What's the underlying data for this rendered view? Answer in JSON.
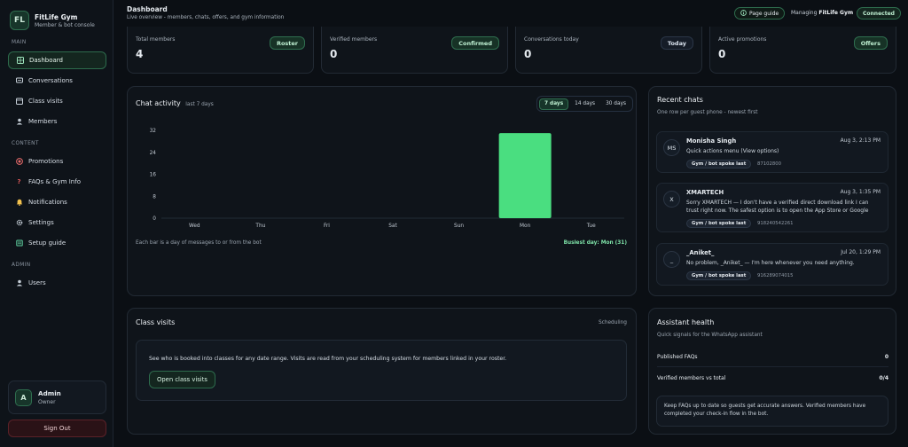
{
  "brand": {
    "logo": "FL",
    "name": "FitLife Gym",
    "subtitle": "Member & bot console"
  },
  "sidebar": {
    "sections": {
      "main": "MAIN",
      "content": "CONTENT",
      "admin": "ADMIN"
    },
    "items": [
      {
        "label": "Dashboard",
        "icon": "grid-icon",
        "active": true
      },
      {
        "label": "Conversations",
        "icon": "chat-icon"
      },
      {
        "label": "Class visits",
        "icon": "calendar-icon"
      },
      {
        "label": "Members",
        "icon": "users-icon"
      },
      {
        "label": "Promotions",
        "icon": "target-icon"
      },
      {
        "label": "FAQs & Gym Info",
        "icon": "question-icon"
      },
      {
        "label": "Notifications",
        "icon": "bell-icon"
      },
      {
        "label": "Settings",
        "icon": "gear-icon"
      },
      {
        "label": "Setup guide",
        "icon": "book-icon"
      },
      {
        "label": "Users",
        "icon": "users-icon"
      }
    ],
    "user": {
      "initial": "A",
      "name": "Admin",
      "role": "Owner"
    },
    "signout": "Sign Out"
  },
  "header": {
    "title": "Dashboard",
    "subtitle": "Live overview - members, chats, offers, and gym information",
    "page_guide": "Page guide",
    "managing_prefix": "Managing",
    "managing_name": "FitLife Gym",
    "status": "Connected"
  },
  "stats": [
    {
      "label": "Total members",
      "value": "4",
      "badge": "Roster",
      "badge_style": "green"
    },
    {
      "label": "Verified members",
      "value": "0",
      "badge": "Confirmed",
      "badge_style": "green"
    },
    {
      "label": "Conversations today",
      "value": "0",
      "badge": "Today",
      "badge_style": "blue"
    },
    {
      "label": "Active promotions",
      "value": "0",
      "badge": "Offers",
      "badge_style": "green"
    }
  ],
  "chat_activity": {
    "title": "Chat activity",
    "subtitle": "last 7 days",
    "ranges": [
      "7 days",
      "14 days",
      "30 days"
    ],
    "active_range": "7 days",
    "footer_note": "Each bar is a day of messages to or from the bot",
    "busiest": "Busiest day: Mon (31)"
  },
  "chart_data": {
    "type": "bar",
    "title": "",
    "categories": [
      "Wed",
      "Thu",
      "Fri",
      "Sat",
      "Sun",
      "Mon",
      "Tue"
    ],
    "values": [
      0,
      0,
      0,
      0,
      0,
      31,
      0
    ],
    "ylim": [
      0,
      32
    ],
    "yticks": [
      0,
      8,
      16,
      24,
      32
    ],
    "grid": false,
    "bar_color": "#4ade80"
  },
  "recent_chats": {
    "title": "Recent chats",
    "subtitle": "One row per guest phone - newest first",
    "items": [
      {
        "initials": "MS",
        "name": "Monisha Singh",
        "time": "Aug 3, 2:13 PM",
        "message": "Quick actions menu (View options)",
        "tag": "Gym / bot spoke last",
        "phone": "87102800"
      },
      {
        "initials": "X",
        "name": "XMARTECH",
        "time": "Aug 3, 1:35 PM",
        "message": "Sorry XMARTECH — I don't have a verified direct download link I can trust right now. The safest option is to open the App Store or Google Play and search for",
        "tag": "Gym / bot spoke last",
        "phone": "918240542261"
      },
      {
        "initials": "_",
        "name": "_Aniket_",
        "time": "Jul 20, 1:29 PM",
        "message": "No problem, _Aniket_ — I'm here whenever you need anything.",
        "tag": "Gym / bot spoke last",
        "phone": "916289074015"
      }
    ]
  },
  "class_visits": {
    "title": "Class visits",
    "right_label": "Scheduling",
    "description": "See who is booked into classes for any date range. Visits are read from your scheduling system for members linked in your roster.",
    "button": "Open class visits"
  },
  "assistant_health": {
    "title": "Assistant health",
    "subtitle": "Quick signals for the WhatsApp assistant",
    "rows": [
      {
        "label": "Published FAQs",
        "value": "0"
      },
      {
        "label": "Verified members vs total",
        "value": "0/4"
      }
    ],
    "note": "Keep FAQs up to date so guests get accurate answers. Verified members have completed your check-in flow in the bot."
  }
}
